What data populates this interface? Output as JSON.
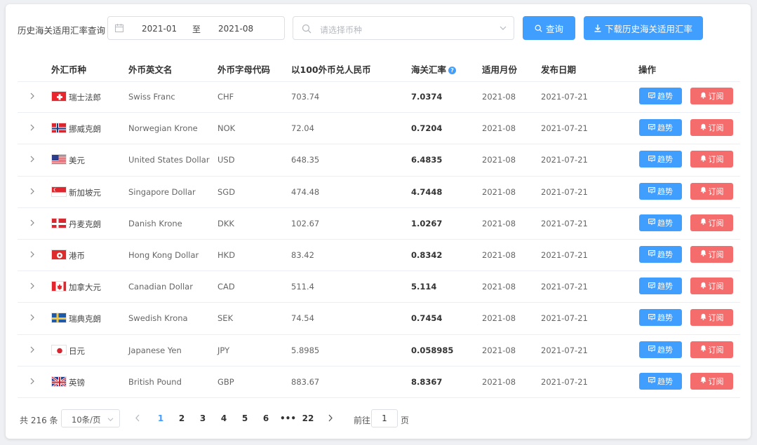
{
  "filter": {
    "label": "历史海关适用汇率查询",
    "date_start": "2021-01",
    "date_separator": "至",
    "date_end": "2021-08",
    "currency_placeholder": "请选择币种",
    "query_label": "查询",
    "download_label": "下载历史海关适用汇率"
  },
  "table": {
    "headers": {
      "currency": "外汇币种",
      "english_name": "外币英文名",
      "code": "外币字母代码",
      "rmb_per_100": "以100外币兑人民币",
      "customs_rate": "海关汇率",
      "applicable_month": "适用月份",
      "publish_date": "发布日期",
      "actions": "操作"
    },
    "trend_label": "趋势",
    "subscribe_label": "订阅",
    "rows": [
      {
        "flag": "ch",
        "name": "瑞士法郎",
        "en": "Swiss Franc",
        "code": "CHF",
        "rmb": "703.74",
        "rate": "7.0374",
        "month": "2021-08",
        "date": "2021-07-21"
      },
      {
        "flag": "no",
        "name": "挪威克朗",
        "en": "Norwegian Krone",
        "code": "NOK",
        "rmb": "72.04",
        "rate": "0.7204",
        "month": "2021-08",
        "date": "2021-07-21"
      },
      {
        "flag": "us",
        "name": "美元",
        "en": "United States Dollar",
        "code": "USD",
        "rmb": "648.35",
        "rate": "6.4835",
        "month": "2021-08",
        "date": "2021-07-21"
      },
      {
        "flag": "sg",
        "name": "新加坡元",
        "en": "Singapore Dollar",
        "code": "SGD",
        "rmb": "474.48",
        "rate": "4.7448",
        "month": "2021-08",
        "date": "2021-07-21"
      },
      {
        "flag": "dk",
        "name": "丹麦克朗",
        "en": "Danish Krone",
        "code": "DKK",
        "rmb": "102.67",
        "rate": "1.0267",
        "month": "2021-08",
        "date": "2021-07-21"
      },
      {
        "flag": "hk",
        "name": "港币",
        "en": "Hong Kong Dollar",
        "code": "HKD",
        "rmb": "83.42",
        "rate": "0.8342",
        "month": "2021-08",
        "date": "2021-07-21"
      },
      {
        "flag": "ca",
        "name": "加拿大元",
        "en": "Canadian Dollar",
        "code": "CAD",
        "rmb": "511.4",
        "rate": "5.114",
        "month": "2021-08",
        "date": "2021-07-21"
      },
      {
        "flag": "se",
        "name": "瑞典克朗",
        "en": "Swedish Krona",
        "code": "SEK",
        "rmb": "74.54",
        "rate": "0.7454",
        "month": "2021-08",
        "date": "2021-07-21"
      },
      {
        "flag": "jp",
        "name": "日元",
        "en": "Japanese Yen",
        "code": "JPY",
        "rmb": "5.8985",
        "rate": "0.058985",
        "month": "2021-08",
        "date": "2021-07-21"
      },
      {
        "flag": "gb",
        "name": "英镑",
        "en": "British Pound",
        "code": "GBP",
        "rmb": "883.67",
        "rate": "8.8367",
        "month": "2021-08",
        "date": "2021-07-21"
      }
    ]
  },
  "pagination": {
    "total": "共 216 条",
    "page_size": "10条/页",
    "pages": [
      "1",
      "2",
      "3",
      "4",
      "5",
      "6",
      "•••",
      "22"
    ],
    "current": "1",
    "goto_label": "前往",
    "goto_value": "1",
    "goto_unit": "页"
  },
  "colors": {
    "primary": "#409eff",
    "danger": "#f56c6c"
  }
}
